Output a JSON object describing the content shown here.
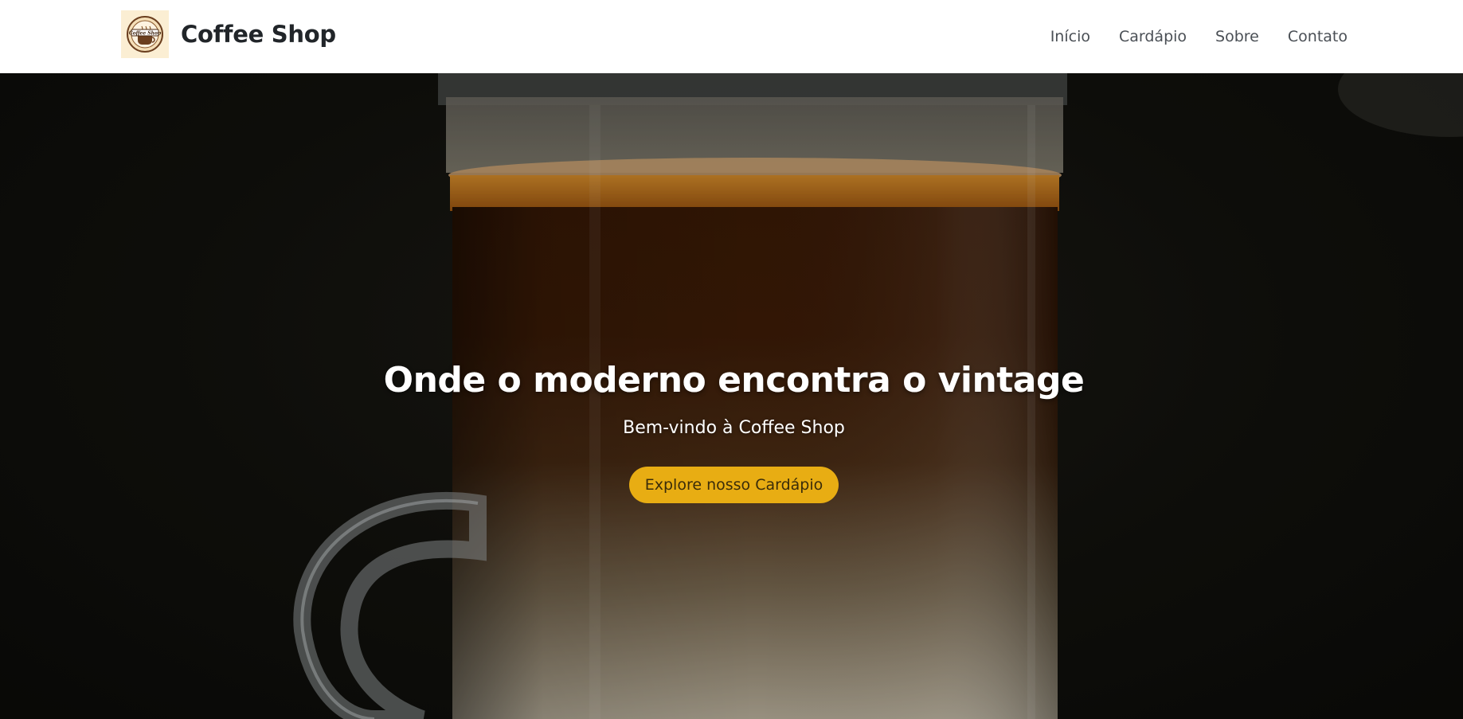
{
  "brand": {
    "name": "Coffee Shop",
    "logo_text": "Coffee Shop",
    "icon": "coffee-cup-logo-icon"
  },
  "nav": {
    "items": [
      {
        "label": "Início"
      },
      {
        "label": "Cardápio"
      },
      {
        "label": "Sobre"
      },
      {
        "label": "Contato"
      }
    ]
  },
  "hero": {
    "title": "Onde o moderno encontra o vintage",
    "subtitle": "Bem-vindo à Coffee Shop",
    "cta_label": "Explore nosso Cardápio",
    "background_image": "glass-of-coffee-photo"
  },
  "colors": {
    "accent": "#e8ad13",
    "navbar_bg": "#ffffff",
    "brand_text": "#212529",
    "nav_text": "#4a4f55",
    "hero_bg": "#0f0f0c"
  }
}
